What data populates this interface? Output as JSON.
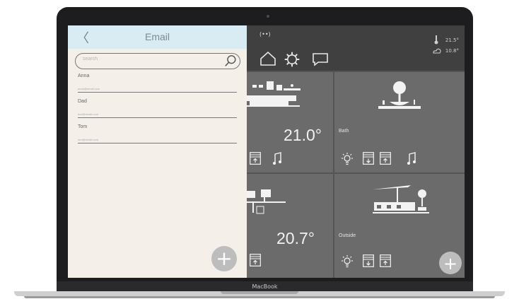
{
  "device": {
    "brand_label": "MacBook"
  },
  "email_panel": {
    "back_glyph": "〈",
    "title": "Email",
    "search": {
      "placeholder": "search",
      "value": ""
    },
    "contacts": [
      {
        "name": "Anna",
        "email": "anna@email.com"
      },
      {
        "name": "Dad",
        "email": "dad@email.com"
      },
      {
        "name": "Tom",
        "email": "tom@email.com"
      }
    ],
    "add_glyph": "+"
  },
  "home": {
    "link_glyph": "(••)",
    "weather": {
      "indoor": "21.5°",
      "outdoor": "10.8°"
    },
    "rooms": [
      {
        "name": "",
        "temperature": "21.0°"
      },
      {
        "name": "Bath",
        "temperature": ""
      },
      {
        "name": "",
        "temperature": "20.7°"
      },
      {
        "name": "Outside",
        "temperature": ""
      }
    ],
    "add_glyph": "+"
  },
  "colors": {
    "email_header": "#d9ecf4",
    "email_background": "#f4efe9",
    "tile_background": "#6b6b6b",
    "topbar_background": "#404040",
    "fab": "#bdbdbd"
  },
  "icons": [
    "chevron-left-icon",
    "search-icon",
    "link-icon",
    "home-icon",
    "gear-icon",
    "chat-icon",
    "thermometer-icon",
    "cloud-sun-icon",
    "blinds-up-icon",
    "blinds-down-icon",
    "music-icon",
    "light-icon",
    "plus-icon"
  ]
}
